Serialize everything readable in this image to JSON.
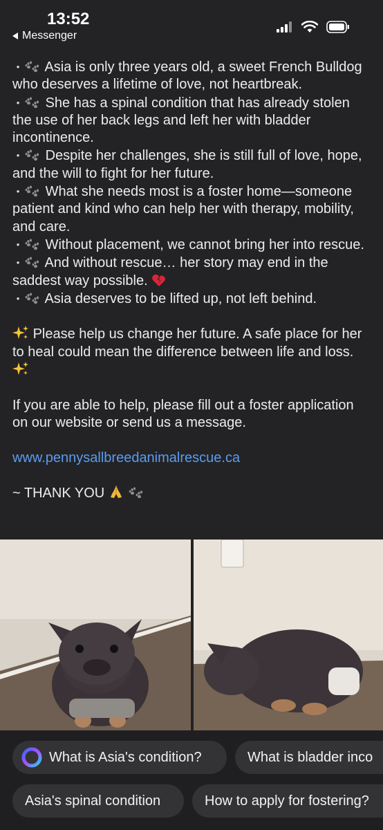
{
  "status_bar": {
    "time": "13:52",
    "back_app": "Messenger",
    "icons": [
      "cellular-signal-icon",
      "wifi-icon",
      "battery-icon"
    ]
  },
  "post": {
    "bullets": [
      "Asia is only three years old, a sweet French Bulldog who deserves a lifetime of love, not heartbreak.",
      "She has a spinal condition that has already stolen the use of her back legs and left her with bladder incontinence.",
      "Despite her challenges, she is still full of love, hope, and the will to fight for her future.",
      "What she needs most is a foster home—someone patient and kind who can help her with therapy, mobility, and care.",
      "Without placement, we cannot bring her into rescue.",
      "And without rescue… her story may end in the saddest way possible.",
      "Asia deserves to be lifted up, not left behind."
    ],
    "bullet_marker": "•",
    "bullet_emoji": "paw-prints-icon",
    "broken_heart_emoji": "broken-heart-icon",
    "plea": "Please help us change her future. A safe place for her to heal could mean the difference between life and loss.",
    "plea_emoji": "sparkles-icon",
    "call_to_action": "If you are able to help, please fill out a foster application on our website or send us a message.",
    "website": "www.pennysallbreedanimalrescue.ca",
    "sign_off": "~ THANK YOU",
    "sign_off_emojis": [
      "folded-hands-icon",
      "paw-prints-icon"
    ]
  },
  "photos": [
    {
      "description_icon": "dog-photo-front"
    },
    {
      "description_icon": "dog-photo-side"
    }
  ],
  "suggestions": {
    "row1": [
      "What is Asia's condition?",
      "What is bladder inco"
    ],
    "row2": [
      "Asia's spinal condition",
      "How to apply for fostering?"
    ]
  },
  "colors": {
    "background": "#232325",
    "text": "#ececec",
    "link": "#5b9cf0",
    "chip_bg": "#333336"
  }
}
